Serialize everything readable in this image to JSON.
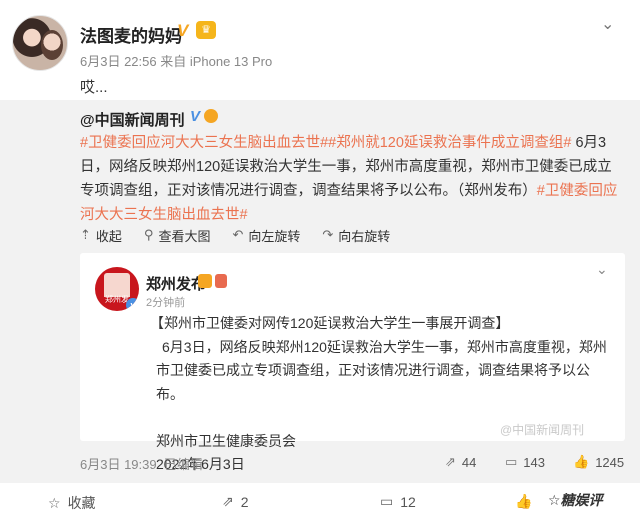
{
  "post": {
    "username": "法图麦的妈妈",
    "v_badge": "V",
    "meta": "6月3日 22:56 来自 iPhone 13 Pro",
    "text": "哎..."
  },
  "repost": {
    "source": "@中国新闻周刊",
    "v_badge": "V",
    "tag1": "#卫健委回应河大大三女生脑出血去世#",
    "tag2": "#郑州就120延误救治事件成立调查组#",
    "text_main": " 6月3日，网络反映郑州120延误救治大学生一事，郑州市高度重视，郑州市卫健委已成立专项调查组，正对该情况进行调查，调查结果将予以公布。（郑州发布）",
    "tag3": "#卫健委回应河大大三女生脑出血去世#",
    "tools": {
      "collapse": "收起",
      "view_large": "查看大图",
      "rotate_left": "向左旋转",
      "rotate_right": "向右旋转"
    },
    "card": {
      "logo_label": "郑州发",
      "name": "郑州发布",
      "time": "2分钟前",
      "title": "【郑州市卫健委对网传120延误救治大学生一事展开调查】",
      "para": "6月3日，网络反映郑州120延误救治大学生一事，郑州市高度重视，郑州市卫健委已成立专项调查组，正对该情况进行调查，调查结果将予以公布。",
      "sign_org": "郑州市卫生健康委员会",
      "sign_date": "2022年6月3日",
      "watermark": "@中国新闻周刊"
    },
    "footer": {
      "date": "6月3日 19:39",
      "edited": "已编辑",
      "reposts": "44",
      "comments": "143",
      "likes": "1245"
    }
  },
  "actions": {
    "favorite": "收藏",
    "share": "2",
    "comment": "12",
    "like": "",
    "brand": "☆糖娱评"
  }
}
